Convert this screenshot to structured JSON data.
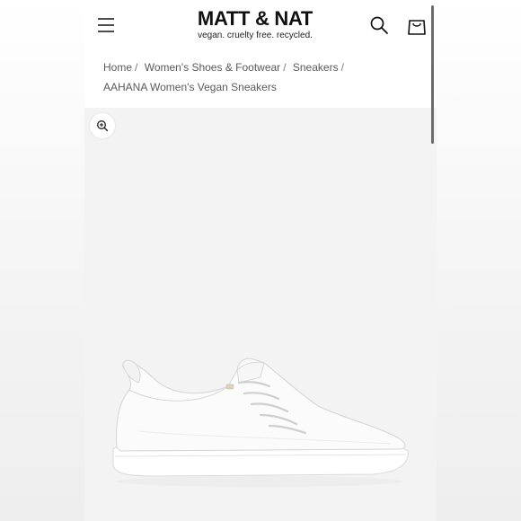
{
  "brand": {
    "name": "MATT & NAT",
    "tagline": "vegan. cruelty free. recycled."
  },
  "header": {
    "menu_icon": "hamburger-menu-icon",
    "search_icon": "search-icon",
    "cart_icon": "shopping-bag-icon"
  },
  "breadcrumb": {
    "items": [
      "Home",
      "Women's Shoes & Footwear",
      "Sneakers",
      "AAHANA Women's Vegan Sneakers"
    ],
    "separator": "/"
  },
  "gallery": {
    "zoom_icon": "zoom-in-icon",
    "image": "white-sneaker-product-image"
  },
  "colors": {
    "gallery_background": "#f3f3f3",
    "text": "#111111",
    "breadcrumb_text": "#5a5a5a"
  }
}
